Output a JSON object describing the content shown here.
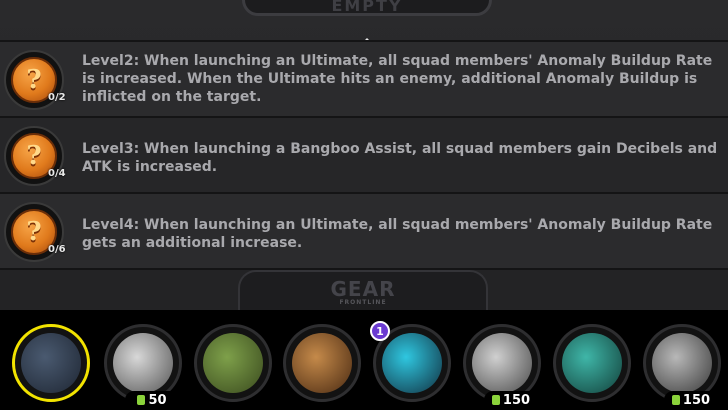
{
  "header": {
    "tab_label": "EMPTY"
  },
  "bonuses": [
    {
      "level_text": "Level2: When launching an Ultimate, all squad members' Anomaly Buildup Rate is increased. When the Ultimate hits an enemy, additional Anomaly Buildup is inflicted on the target.",
      "progress": "0/2",
      "icon": "question-medal-icon"
    },
    {
      "level_text": "Level3: When launching a Bangboo Assist, all squad members gain Decibels and ATK is increased.",
      "progress": "0/4",
      "icon": "question-medal-icon"
    },
    {
      "level_text": "Level4: When launching an Ultimate, all squad members' Anomaly Buildup Rate gets an additional increase.",
      "progress": "0/6",
      "icon": "question-medal-icon"
    }
  ],
  "footer": {
    "logo": "GEAR",
    "sub": "FRONTLINE"
  },
  "slots": [
    {
      "name": "squad-bangboo",
      "price": "",
      "selected": true
    },
    {
      "name": "silver-bangboo",
      "price": "50"
    },
    {
      "name": "green-bangboo",
      "price": ""
    },
    {
      "name": "brown-bangboo",
      "price": ""
    },
    {
      "name": "blue-bangboo",
      "price": "",
      "rank": "1"
    },
    {
      "name": "paper-bangboo",
      "price": "150"
    },
    {
      "name": "teal-bangboo",
      "price": ""
    },
    {
      "name": "gray-bangboo",
      "price": "150"
    }
  ],
  "colors": {
    "accent_yellow": "#f2e300",
    "price_tag": "#8bd33b",
    "medal": "#e07a1c"
  }
}
